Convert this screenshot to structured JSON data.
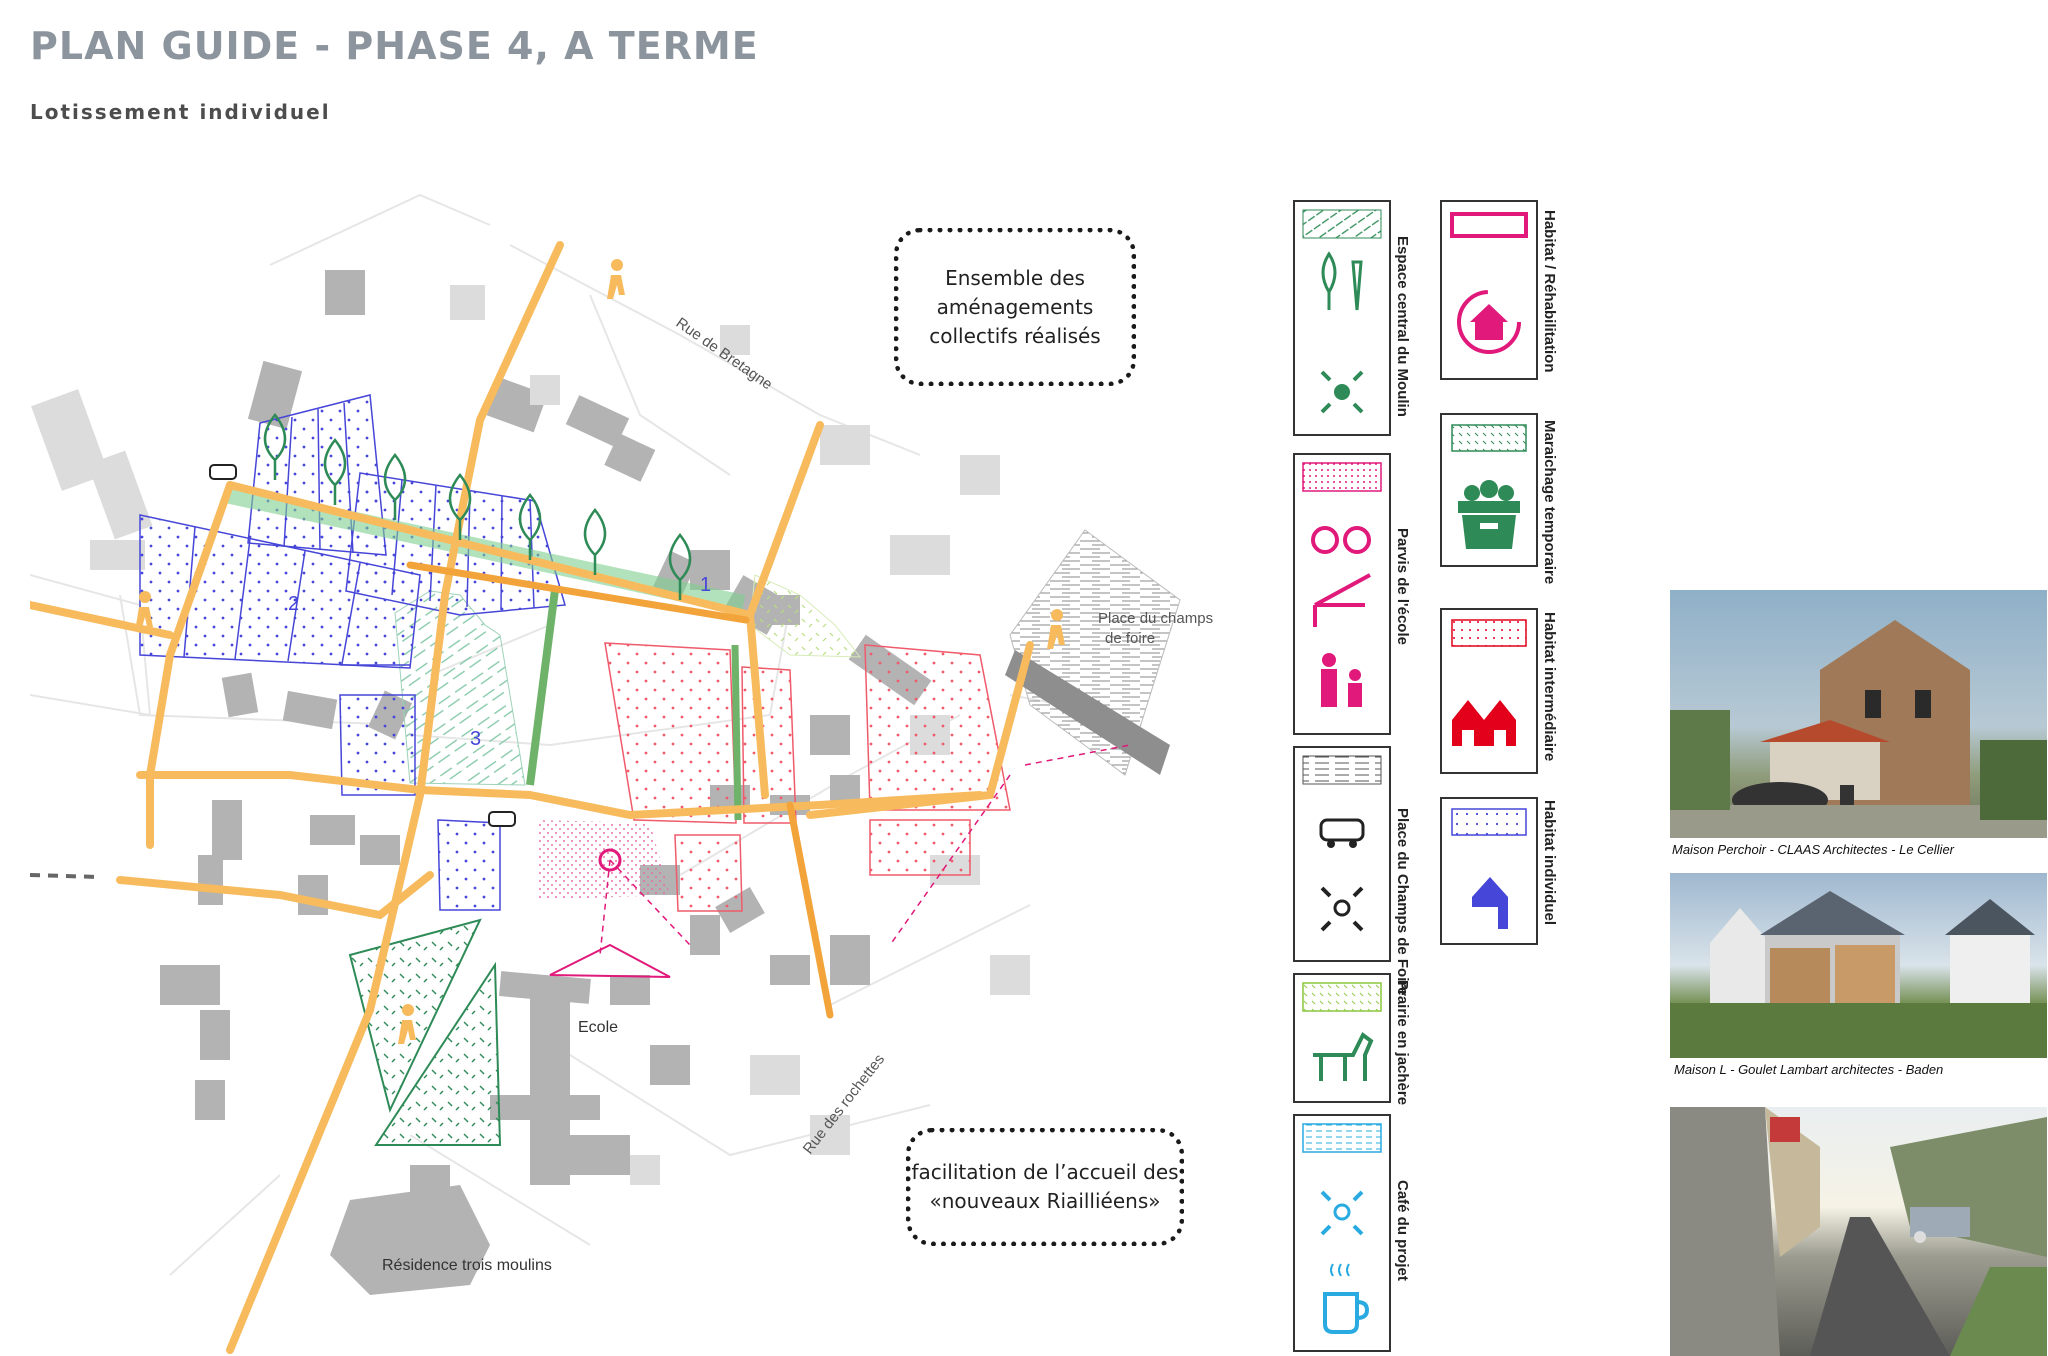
{
  "header": {
    "title": "PLAN GUIDE - PHASE 4, A TERME",
    "subtitle": "Lotissement individuel"
  },
  "map": {
    "street_labels": {
      "rue_bretagne": "Rue de Bretagne",
      "rue_rochettes": "Rue des rochettes"
    },
    "place_labels": {
      "champs_foire_line1": "Place du champs",
      "champs_foire_line2": "de foire",
      "ecole": "Ecole",
      "residence": "Résidence trois moulins"
    },
    "lot_numbers": [
      "1",
      "2",
      "3"
    ]
  },
  "callouts": {
    "top": [
      "Ensemble des",
      "aménagements",
      "collectifs réalisés"
    ],
    "bottom": [
      "facilitation de l’accueil des",
      "«nouveaux Riailliéens»"
    ]
  },
  "legend": {
    "items": [
      {
        "key": "espace_central",
        "label": "Espace central du Moulin"
      },
      {
        "key": "parvis_ecole",
        "label": "Parvis de l'école"
      },
      {
        "key": "place_champs",
        "label": "Place du Champs de Foire"
      },
      {
        "key": "prairie",
        "label": "Prairie en jachère"
      },
      {
        "key": "cafe",
        "label": "Café du projet"
      },
      {
        "key": "habitat_rehab",
        "label": "Habitat / Réhabilitation"
      },
      {
        "key": "maraichage",
        "label": "Maraichage temporaire"
      },
      {
        "key": "habitat_inter",
        "label": "Habitat intermédiaire"
      },
      {
        "key": "habitat_indiv",
        "label": "Habitat individuel"
      }
    ]
  },
  "photos": {
    "captions": [
      "Maison Perchoir - CLAAS Architectes - Le Cellier",
      "Maison L - Goulet Lambart architectes - Baden"
    ]
  },
  "colors": {
    "path": "#f7bb5e",
    "path_dark": "#f2a33a",
    "green": "#2e8b57",
    "pink": "#e0197a",
    "red": "#e2001a",
    "blue": "#4646d8",
    "light_green": "#8cc63f",
    "cyan": "#29abe2",
    "building": "#b3b3b3"
  }
}
